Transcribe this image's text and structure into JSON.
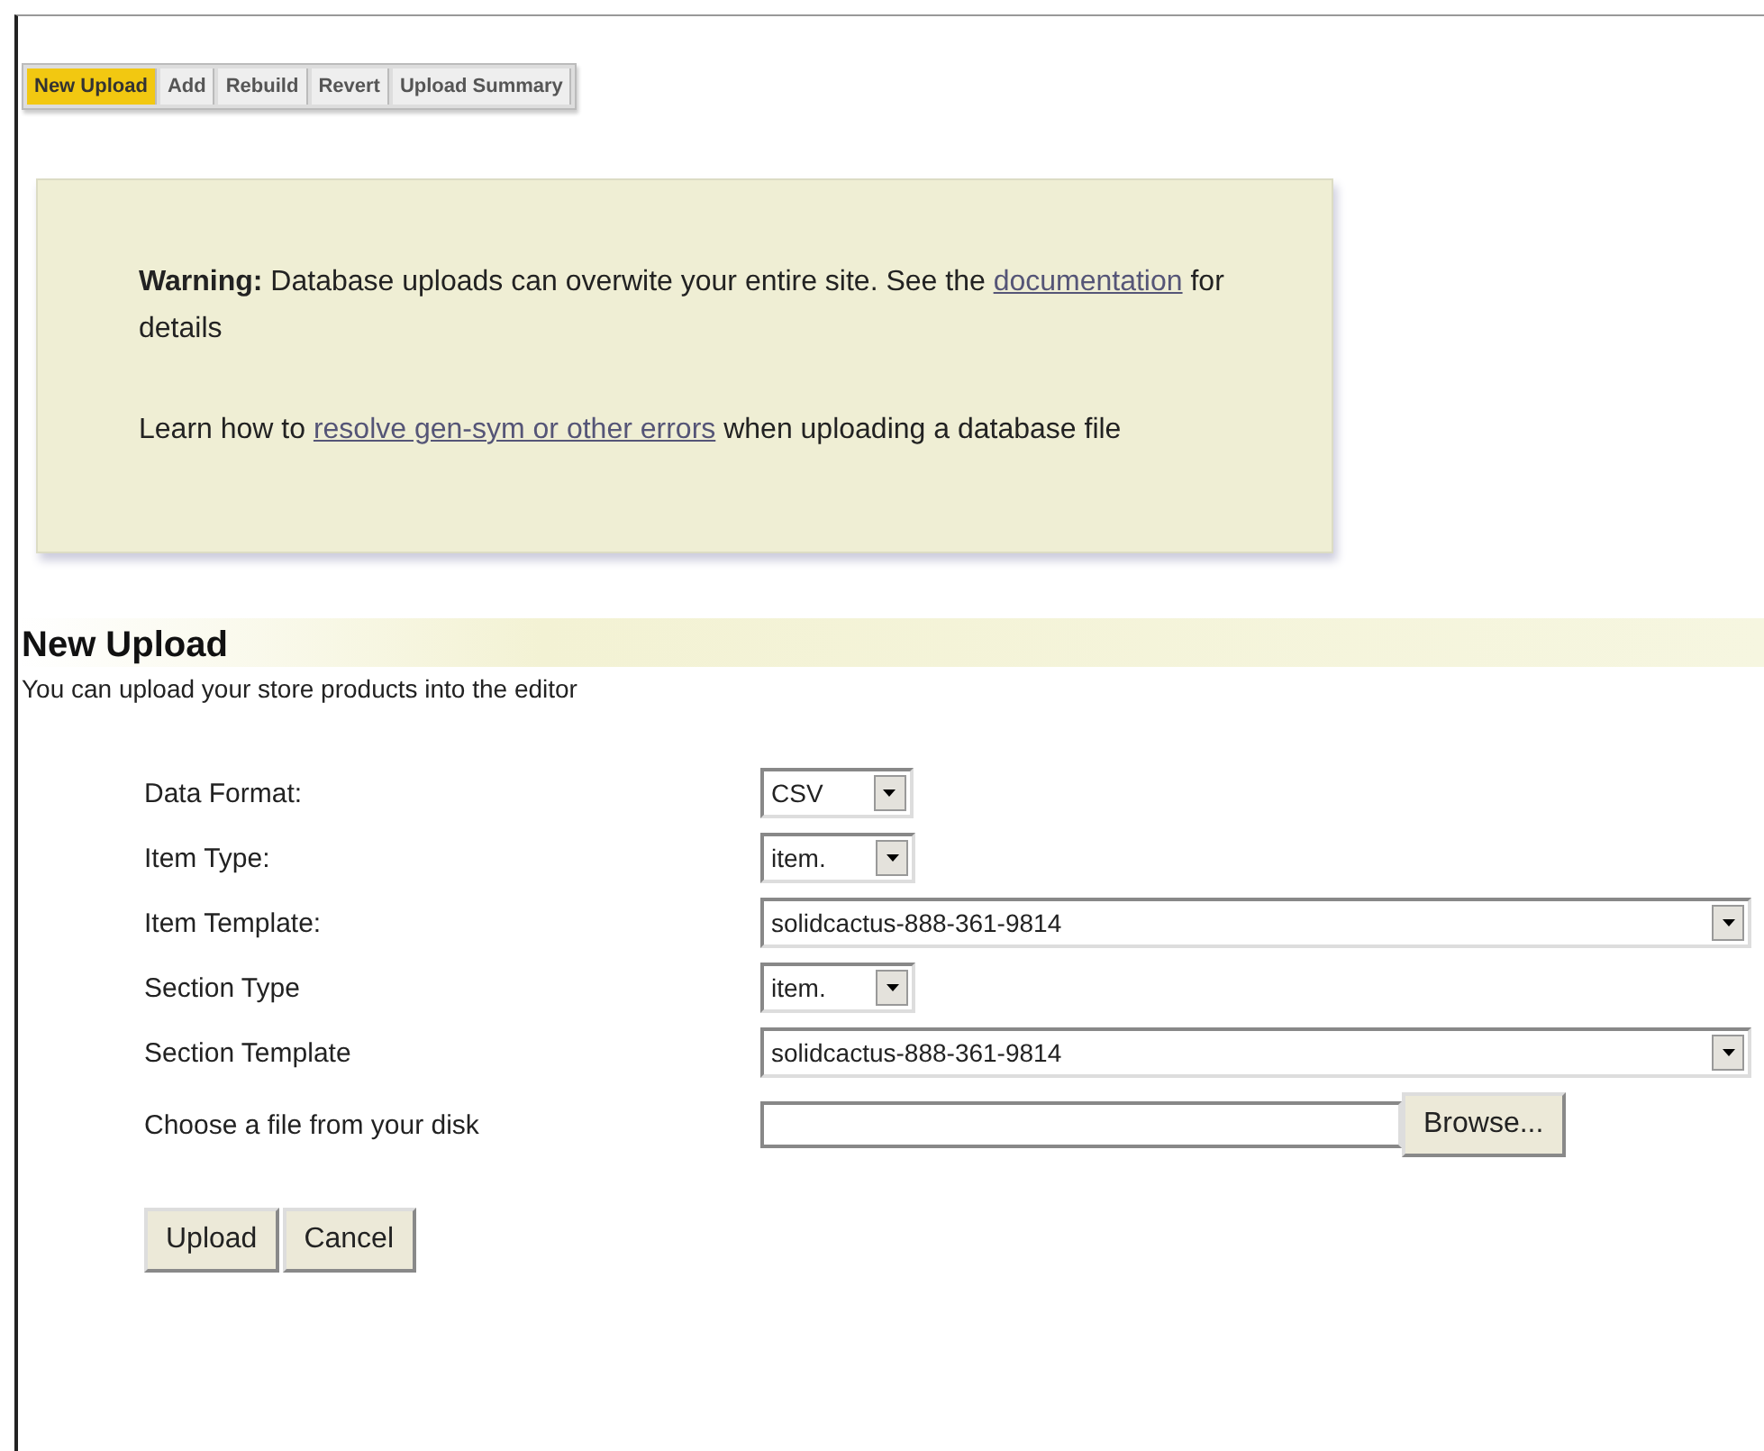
{
  "tabs": [
    {
      "label": "New Upload",
      "selected": true
    },
    {
      "label": "Add",
      "selected": false
    },
    {
      "label": "Rebuild",
      "selected": false
    },
    {
      "label": "Revert",
      "selected": false
    },
    {
      "label": "Upload Summary",
      "selected": false
    }
  ],
  "notice": {
    "paragraphs": [
      {
        "lead": "**Warning:** Database uploads can overwite your entire site. See the",
        "link": "documentation",
        "tail": "for details"
      },
      {
        "lead": "Learn how to",
        "link": "resolve gen-sym or other errors",
        "tail": "when uploading a database file"
      }
    ]
  },
  "section": {
    "title": "New Upload",
    "subtitle": "You can upload your store products into the editor"
  },
  "fields": [
    {
      "label": "Data Format:",
      "kind": "select",
      "value": "CSV"
    },
    {
      "label": "Item Type:",
      "kind": "select",
      "value": "item."
    },
    {
      "label": "Item Template:",
      "kind": "wide-select",
      "value": "solidcactus-888-361-9814"
    },
    {
      "label": "Section Type",
      "kind": "select",
      "value": "item."
    },
    {
      "label": "Section Template",
      "kind": "wide-select",
      "value": "solidcactus-888-361-9814"
    },
    {
      "label": "Choose a file from your disk",
      "kind": "file",
      "button": "Browse..."
    }
  ],
  "buttons": [
    "Upload",
    "Cancel"
  ]
}
